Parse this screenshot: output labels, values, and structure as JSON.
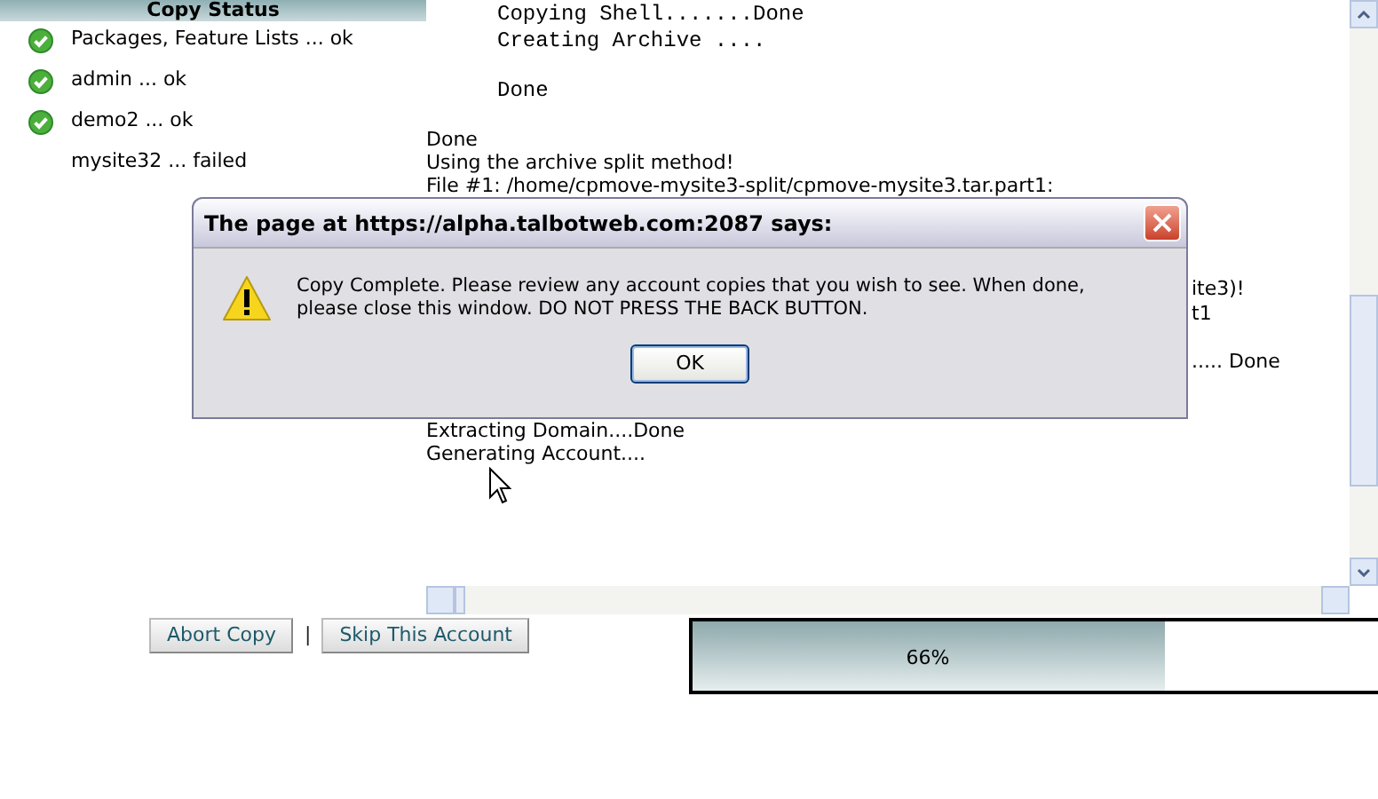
{
  "copy_status": {
    "title": "Copy Status",
    "items": [
      {
        "label": "Packages, Feature Lists ... ok",
        "ok": true
      },
      {
        "label": "admin ... ok",
        "ok": true
      },
      {
        "label": "demo2 ... ok",
        "ok": true
      },
      {
        "label": "mysite32 ... failed",
        "ok": false
      }
    ]
  },
  "log": {
    "lines": [
      {
        "text": "Copying Shell.......Done",
        "kind": "mono"
      },
      {
        "text": "Creating Archive ....",
        "kind": "mono"
      },
      {
        "kind": "gap"
      },
      {
        "text": "Done",
        "kind": "mono"
      },
      {
        "kind": "gap"
      },
      {
        "text": "Done",
        "kind": "sans"
      },
      {
        "text": "Using the archive split method!",
        "kind": "sans"
      },
      {
        "text": "File #1: /home/cpmove-mysite3-split/cpmove-mysite3.tar.part1:",
        "kind": "sans"
      }
    ],
    "fragments": [
      "ite3)!",
      "t1",
      "..... Done"
    ],
    "tail": [
      "Extracting Domain....Done",
      "Generating Account...."
    ]
  },
  "buttons": [
    "Abort Copy",
    "Skip This Account"
  ],
  "separator": "|",
  "progress": {
    "level": 0.69,
    "label": "66%"
  },
  "dialog": {
    "title": "The page at https://alpha.talbotweb.com:2087 says:",
    "message": "Copy Complete.  Please review any account copies that you wish to see.  When done, please close this window.  DO NOT PRESS THE BACK BUTTON.",
    "button": "OK"
  }
}
